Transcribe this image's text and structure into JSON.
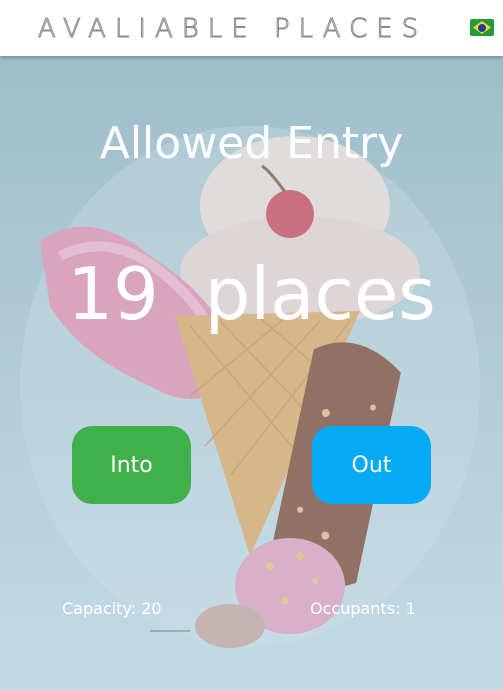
{
  "header": {
    "title": "AVALIABLE PLACES",
    "flag_icon": "brazil-flag-icon",
    "colors": {
      "background": "#ffffff",
      "title_outline": "#8a8a8a"
    }
  },
  "main": {
    "status_title": "Allowed Entry",
    "places_count": "19  places",
    "buttons": {
      "into_label": "Into",
      "out_label": "Out"
    },
    "capacity_text": "Capacity: 20",
    "occupants_text": "Occupants: 1"
  },
  "colors": {
    "into_button": "#3fb04a",
    "out_button": "#06a9f4",
    "text": "#ffffff",
    "background_tint": "#a9c4cf"
  }
}
